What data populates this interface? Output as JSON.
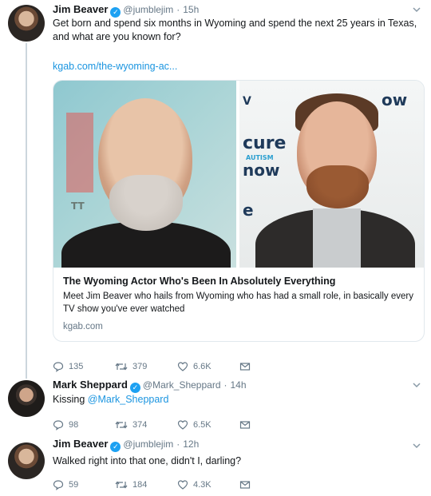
{
  "tweets": [
    {
      "name": "Jim Beaver",
      "handle": "@jumblejim",
      "time": "15h",
      "text": "Get born and spend six months in Wyoming and spend the next 25 years in Texas, and what are you known for?",
      "link": "kgab.com/the-wyoming-ac...",
      "card": {
        "title": "The Wyoming Actor Who's Been In Absolutely Everything",
        "description": "Meet Jim Beaver who hails from Wyoming who has had a small role, in basically every TV show you've ever watched",
        "domain": "kgab.com",
        "backdrop_words": [
          "cure",
          "now",
          "AUTISM",
          "ow",
          "e",
          "V",
          "TT"
        ]
      },
      "actions": {
        "replies": "135",
        "retweets": "379",
        "likes": "6.6K"
      }
    },
    {
      "name": "Mark Sheppard",
      "handle": "@Mark_Sheppard",
      "time": "14h",
      "text_prefix": "Kissing ",
      "mention": "@Mark_Sheppard",
      "actions": {
        "replies": "98",
        "retweets": "374",
        "likes": "6.5K"
      }
    },
    {
      "name": "Jim Beaver",
      "handle": "@jumblejim",
      "time": "12h",
      "text": "Walked right into that one, didn't I, darling?",
      "actions": {
        "replies": "59",
        "retweets": "184",
        "likes": "4.3K"
      }
    }
  ],
  "separator": "·",
  "icons": {
    "reply": "reply-icon",
    "retweet": "retweet-icon",
    "like": "heart-icon",
    "dm": "envelope-icon",
    "verified": "verified-badge-icon",
    "caret": "chevron-down-icon"
  },
  "colors": {
    "link": "#1b95e0",
    "verified": "#1da1f2",
    "muted": "#657786"
  }
}
